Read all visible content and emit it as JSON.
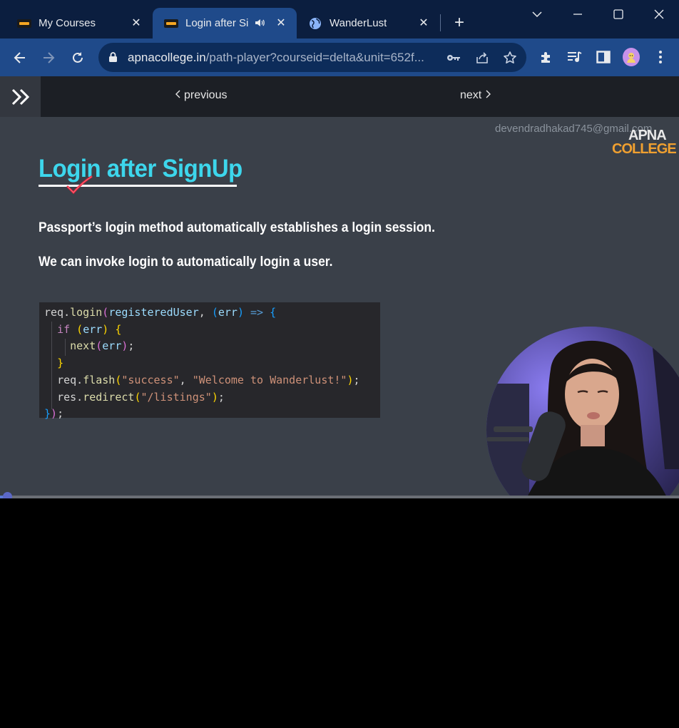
{
  "browser": {
    "tabs": [
      {
        "title": "My Courses",
        "icon": "apna-college-favicon",
        "active": false
      },
      {
        "title": "Login after Si",
        "icon": "apna-college-favicon",
        "active": true,
        "audio": true
      },
      {
        "title": "WanderLust",
        "icon": "globe-icon",
        "active": false
      }
    ],
    "close_glyph": "✕",
    "newtab_glyph": "+",
    "url_host": "apnacollege.in",
    "url_path": "/path-player?courseid=delta&unit=652f..."
  },
  "page_nav": {
    "previous_label": "previous",
    "next_label": "next"
  },
  "slide": {
    "watermark": "devendradhakad745@gmail.com",
    "brand_line1": "APNA",
    "brand_line2": "COLLEGE",
    "title": "Login after SignUp",
    "para1": "Passport’s login method automatically establishes a login session.",
    "para2": "We can invoke login to automatically login a user."
  },
  "code": {
    "l1_obj": "req",
    "l1_fn": "login",
    "l1_arg": "registeredUser",
    "l1_param": "err",
    "l2_kw": "if",
    "l2_var": "err",
    "l3_fn": "next",
    "l3_var": "err",
    "l5_obj": "req",
    "l5_fn": "flash",
    "l5_s1": "\"success\"",
    "l5_s2": "\"Welcome to Wanderlust!\"",
    "l6_obj": "res",
    "l6_fn": "redirect",
    "l6_s1": "\"/listings\""
  },
  "colors": {
    "tabstrip": "#0b1e3f",
    "toolbar": "#1f4a8a",
    "slide_bg": "#3a4049",
    "title": "#3dd6ec",
    "brand_orange": "#f0a030"
  },
  "video": {
    "progress_fraction": 0.01
  }
}
